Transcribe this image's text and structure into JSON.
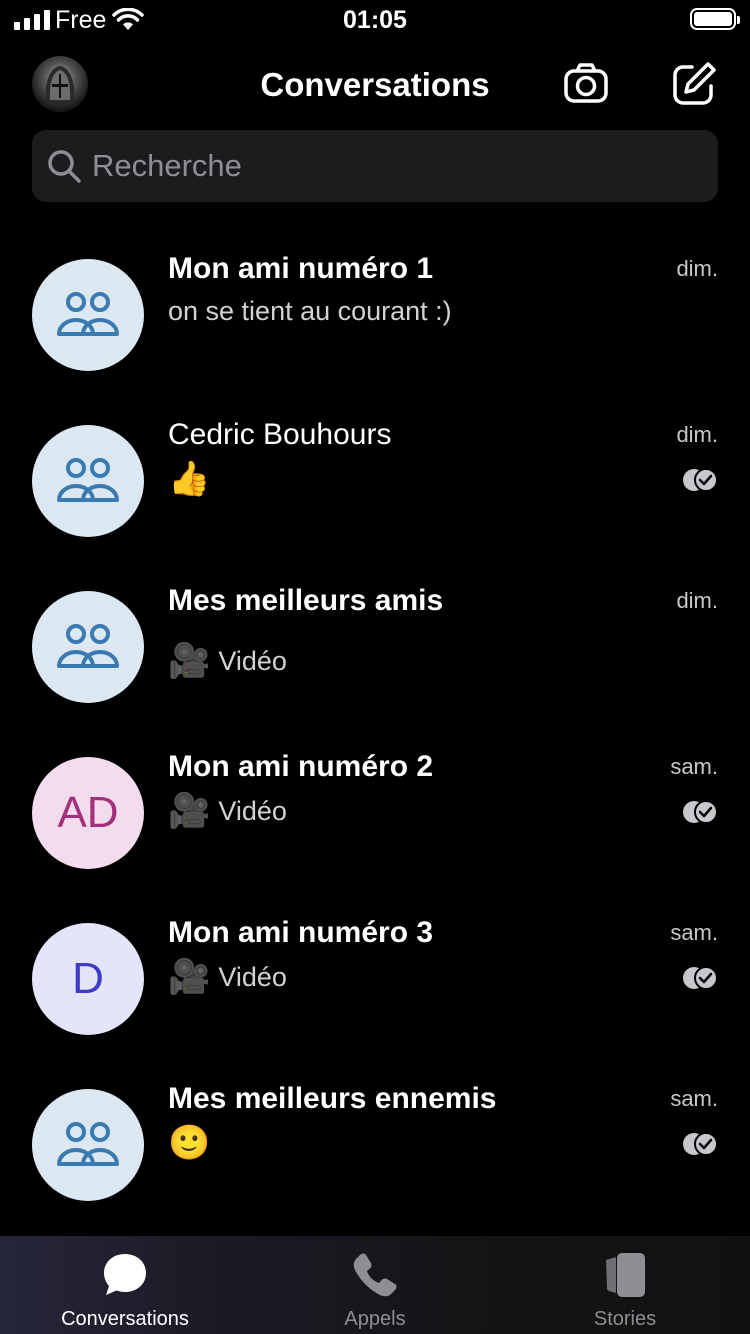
{
  "status_bar": {
    "carrier": "Free",
    "time": "01:05",
    "battery_level": 1.0
  },
  "header": {
    "title": "Conversations",
    "camera_icon": "camera-icon",
    "compose_icon": "compose-icon"
  },
  "search": {
    "placeholder": "Recherche"
  },
  "conversations": [
    {
      "name": "Mon ami numéro 1",
      "preview": "on se tient au courant :)",
      "date": "dim.",
      "avatar": "group-icon",
      "read": false
    },
    {
      "name": "Cedric Bouhours",
      "preview": "👍",
      "date": "dim.",
      "avatar": "group-icon",
      "read": true
    },
    {
      "name": "Mes meilleurs amis",
      "preview": "Vidéo",
      "preview_icon": "🎥",
      "date": "dim.",
      "avatar": "group-icon",
      "read": false
    },
    {
      "name": "Mon ami numéro 2",
      "preview": "Vidéo",
      "preview_icon": "🎥",
      "date": "sam.",
      "avatar_initials": "AD",
      "read": true
    },
    {
      "name": "Mon ami numéro 3",
      "preview": "Vidéo",
      "preview_icon": "🎥",
      "date": "sam.",
      "avatar_initials": "D",
      "read": true
    },
    {
      "name": "Mes meilleurs ennemis",
      "preview": "🙂",
      "date": "sam.",
      "avatar": "group-icon",
      "read": true
    }
  ],
  "tabs": [
    {
      "label": "Conversations",
      "icon": "chat-bubble-icon",
      "active": true
    },
    {
      "label": "Appels",
      "icon": "phone-icon",
      "active": false
    },
    {
      "label": "Stories",
      "icon": "stories-icon",
      "active": false
    }
  ],
  "colors": {
    "background": "#000000",
    "search_bg": "#1c1c1e",
    "group_avatar_bg": "#dbe8f1",
    "group_icon": "#3b7ab0",
    "avatar_ad_bg": "#f2dcee",
    "avatar_ad_text": "#a3307a",
    "avatar_d_bg": "#e4e4fb",
    "avatar_d_text": "#3c3cc8"
  }
}
